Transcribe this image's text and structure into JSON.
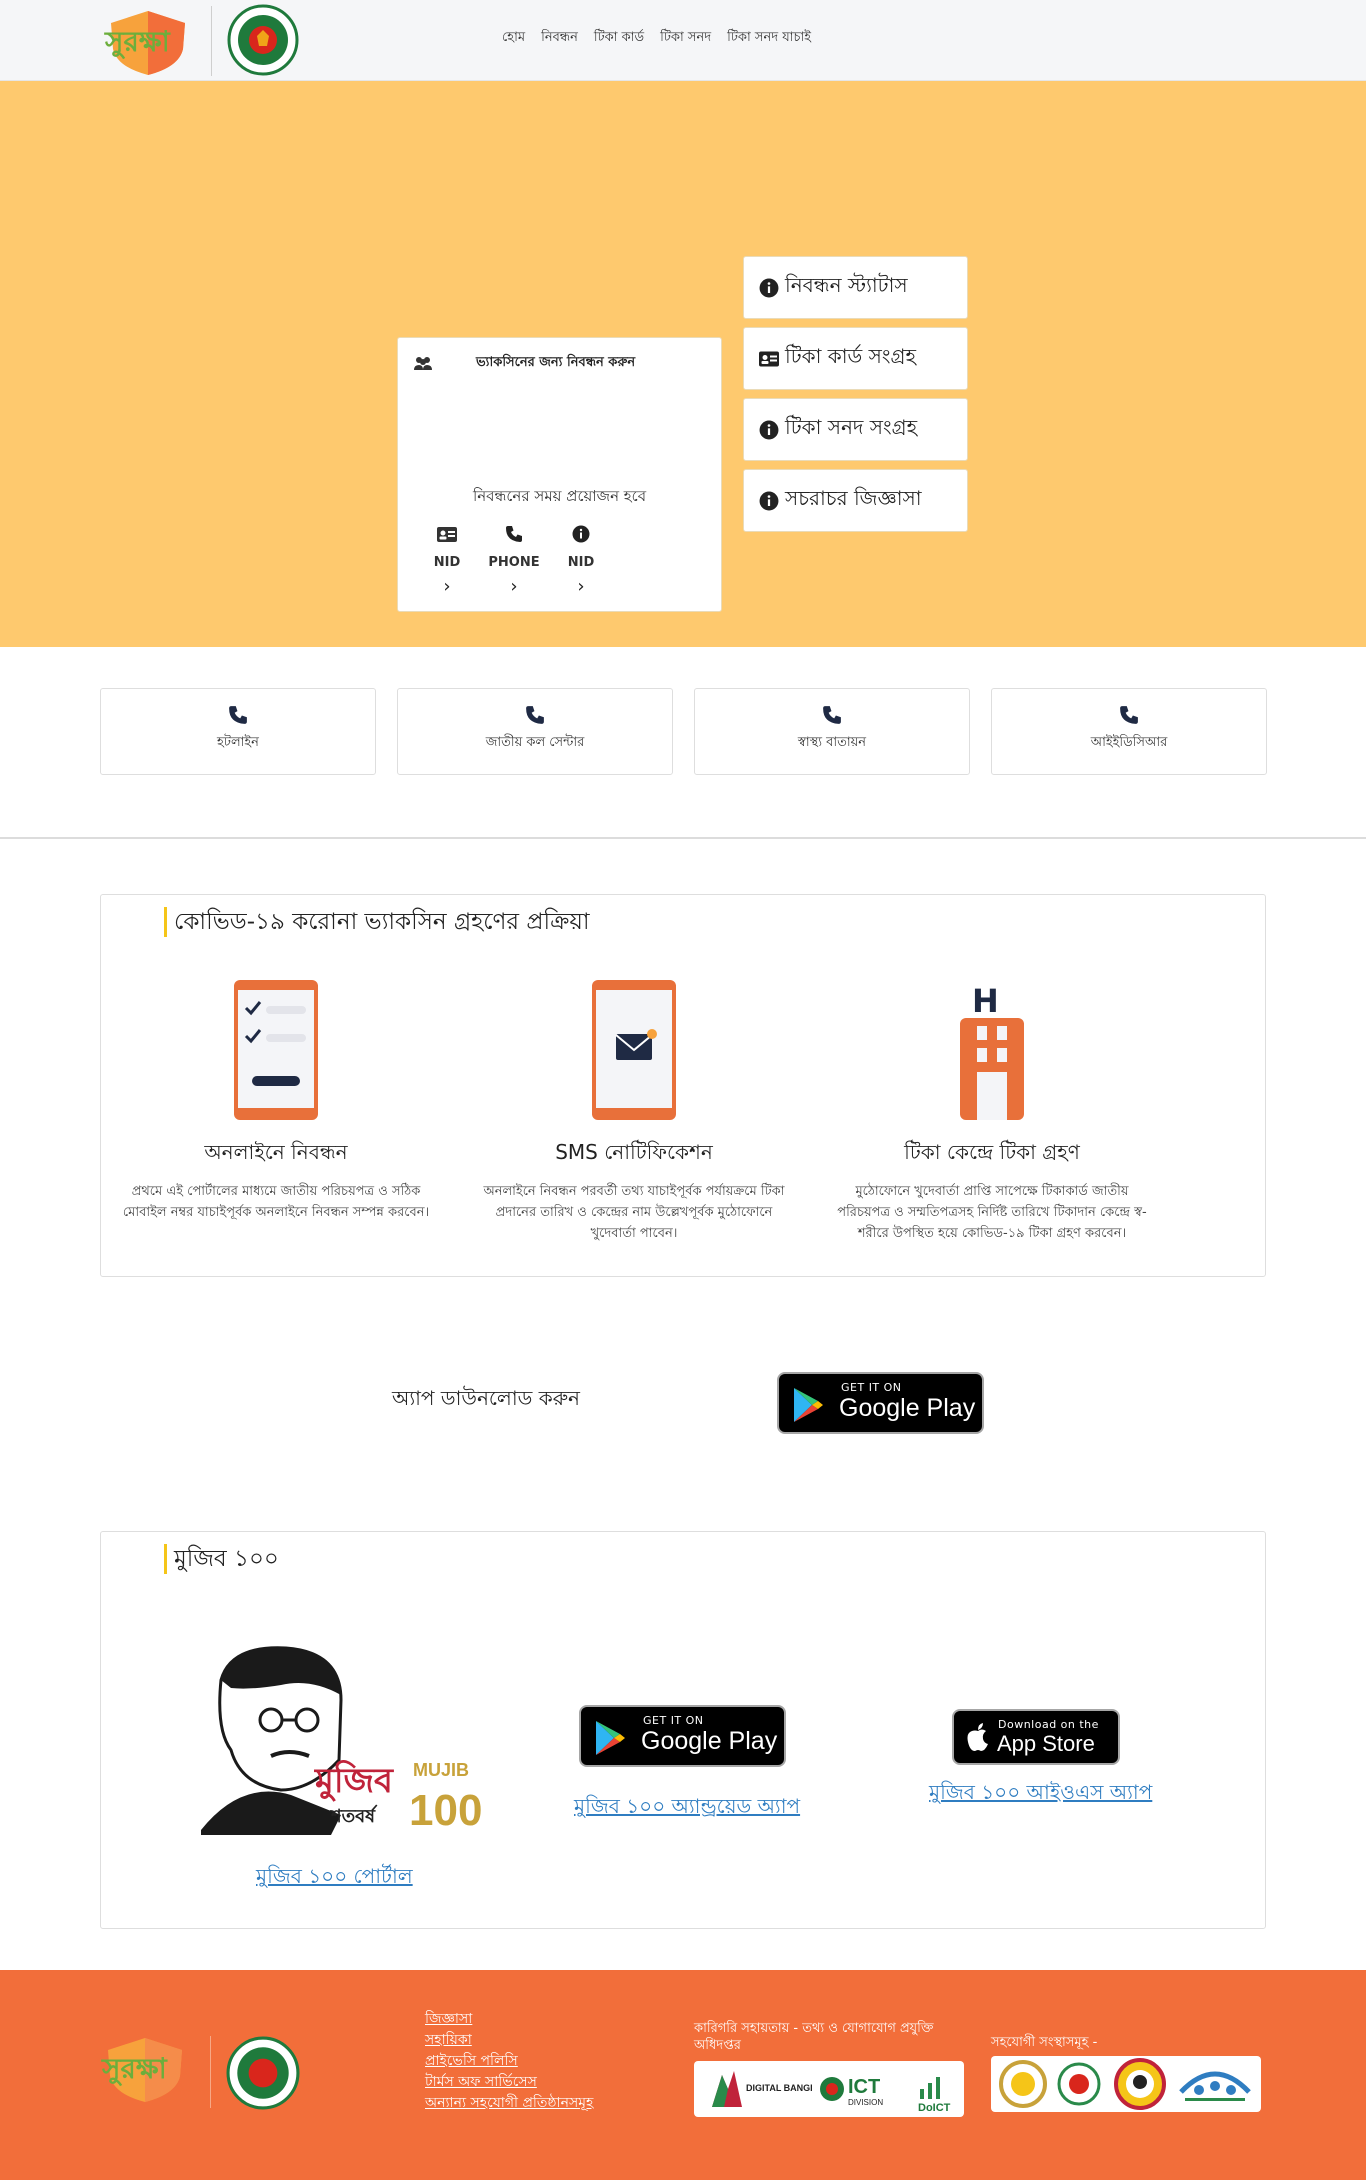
{
  "header": {
    "logo_text": "সুরক্ষা",
    "nav": [
      "হোম",
      "নিবন্ধন",
      "টিকা কার্ড",
      "টিকা সনদ",
      "টিকা সনদ যাচাই"
    ]
  },
  "hero": {
    "register_card": {
      "title": "ভ্যাকসিনের জন্য নিবন্ধন করুন",
      "needed_label": "নিবন্ধনের সময় প্রয়োজন হবে",
      "options": [
        {
          "label": "NID",
          "icon": "id-card-icon"
        },
        {
          "label": "PHONE",
          "icon": "phone-icon"
        },
        {
          "label": "NID",
          "icon": "info-icon"
        }
      ],
      "chevron": "›"
    },
    "side_buttons": [
      {
        "label": "নিবন্ধন স্ট্যাটাস",
        "icon": "info-icon"
      },
      {
        "label": "টিকা কার্ড সংগ্রহ",
        "icon": "id-card-icon"
      },
      {
        "label": "টিকা সনদ সংগ্রহ",
        "icon": "info-icon"
      },
      {
        "label": "সচরাচর জিজ্ঞাসা",
        "icon": "info-icon"
      }
    ]
  },
  "hotlines": [
    "হটলাইন",
    "জাতীয় কল সেন্টার",
    "স্বাস্থ্য বাতায়ন",
    "আইইডিসিআর"
  ],
  "process": {
    "title": "কোভিড-১৯ করোনা ভ্যাকসিন গ্রহণের প্রক্রিয়া",
    "steps": [
      {
        "title": "অনলাইনে নিবন্ধন",
        "desc": "প্রথমে এই পোর্টালের মাধ্যমে জাতীয় পরিচয়পত্র ও সঠিক মোবাইল নম্বর যাচাইপূর্বক অনলাইনে নিবন্ধন সম্পন্ন করবেন।"
      },
      {
        "title": "SMS নোটিফিকেশন",
        "desc": "অনলাইনে নিবন্ধন পরবর্তী তথ্য যাচাইপূর্বক পর্যায়ক্রমে টিকা প্রদানের তারিখ ও কেন্দ্রের নাম উল্লেখপূর্বক মুঠোফোনে খুদেবার্তা পাবেন।"
      },
      {
        "title": "টিকা কেন্দ্রে টিকা গ্রহণ",
        "desc": "মুঠোফোনে খুদেবার্তা প্রাপ্তি সাপেক্ষে টিকাকার্ড জাতীয় পরিচয়পত্র ও সম্মতিপত্রসহ নির্দিষ্ট তারিখে টিকাদান কেন্দ্রে স্ব-শরীরে উপস্থিত হয়ে কোভিড-১৯ টিকা গ্রহণ করবেন।"
      }
    ]
  },
  "app_download": {
    "label": "অ্যাপ ডাউনলোড করুন",
    "badge_small": "GET IT ON",
    "badge_big": "Google Play"
  },
  "mujib": {
    "title": "মুজিব ১০০",
    "logo_words": {
      "bn": "মুজিব",
      "sub": "শতবর্ষ",
      "en": "MUJIB",
      "num": "100"
    },
    "portal_link": "মুজিব ১০০ পোর্টাল",
    "android_link": "মুজিব ১০০ অ্যান্ড্রয়েড অ্যাপ",
    "ios_link": "মুজিব ১০০ আইওএস অ্যাপ",
    "gp_small": "GET IT ON",
    "gp_big": "Google Play",
    "as_small": "Download on the",
    "as_big": "App Store"
  },
  "footer": {
    "links": [
      "জিজ্ঞাসা",
      "সহায়িকা",
      "প্রাইভেসি পলিসি",
      "টার্মস অফ সার্ভিসেস",
      "অন্যান্য সহযোগী প্রতিষ্ঠানসমূহ"
    ],
    "tech_support": "কারিগরি সহায়তায় - তথ্য ও যোগাযোগ প্রযুক্তি অধিদপ্তর",
    "tech_logos": {
      "digital": "DIGITAL BANGLADESH",
      "ict": "ICT",
      "division": "DIVISION",
      "doict": "DoICT"
    },
    "partners_label": "সহযোগী সংস্থাসমূহ -"
  },
  "colors": {
    "hero_bg": "#fec96e",
    "footer_bg": "#f26e3a",
    "accent": "#f5c518",
    "link": "#2f7dc1",
    "icon_orange": "#e8703a"
  }
}
